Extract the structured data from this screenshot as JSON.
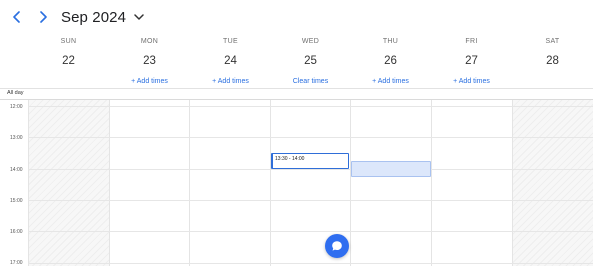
{
  "header": {
    "month_label": "Sep 2024",
    "prev_icon": "chevron-left-icon",
    "next_icon": "chevron-right-icon",
    "dropdown_icon": "chevron-down-icon"
  },
  "days": [
    {
      "name": "SUN",
      "date": "22",
      "action": ""
    },
    {
      "name": "MON",
      "date": "23",
      "action": "+ Add times"
    },
    {
      "name": "TUE",
      "date": "24",
      "action": "+ Add times"
    },
    {
      "name": "WED",
      "date": "25",
      "action": "Clear times"
    },
    {
      "name": "THU",
      "date": "26",
      "action": "+ Add times"
    },
    {
      "name": "FRI",
      "date": "27",
      "action": "+ Add times"
    },
    {
      "name": "SAT",
      "date": "28",
      "action": ""
    }
  ],
  "all_day_label": "All day",
  "time_labels": [
    "12:00",
    "13:00",
    "14:00",
    "15:00",
    "16:00",
    "17:00"
  ],
  "events": {
    "selected": {
      "label": "13:30 - 14:00",
      "day": "WED"
    },
    "ghost": {
      "day": "THU"
    }
  },
  "fab": {
    "icon": "chat-bubble-icon"
  },
  "colors": {
    "accent": "#2f6ef0",
    "link": "#2a6fe0",
    "ghost_fill": "#dce7fb",
    "weekend_fill": "#f7f7f7"
  }
}
